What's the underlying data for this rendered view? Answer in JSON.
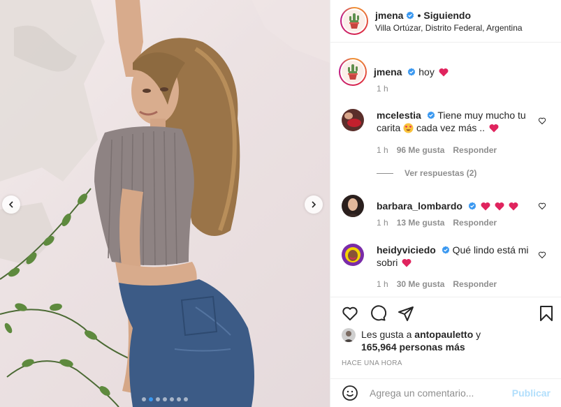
{
  "post": {
    "username": "jmena",
    "following_label": "Siguiendo",
    "location": "Villa Ortúzar, Distrito Federal, Argentina"
  },
  "caption": {
    "username": "jmena",
    "text": "hoy",
    "time": "1 h"
  },
  "comments": [
    {
      "username": "mcelestia",
      "text_part1": "Tiene muy mucho tu carita",
      "text_part2": "cada vez más ..",
      "time": "1 h",
      "likes": "96 Me gusta",
      "reply_label": "Responder",
      "view_replies": "Ver respuestas (2)"
    },
    {
      "username": "barbara_lombardo",
      "text": "",
      "time": "1 h",
      "likes": "13 Me gusta",
      "reply_label": "Responder"
    },
    {
      "username": "heidyviciedo",
      "text": "Qué lindo está mi sobri",
      "time": "1 h",
      "likes": "30 Me gusta",
      "reply_label": "Responder"
    }
  ],
  "likes": {
    "prefix": "Les gusta a",
    "user": "antopauletto",
    "conj": "y",
    "others": "165,964 personas más"
  },
  "posted_ago": "HACE UNA HORA",
  "composer": {
    "placeholder": "Agrega un comentario...",
    "publish_label": "Publicar"
  },
  "carousel": {
    "count": 7,
    "active": 1
  },
  "icons": [
    "verified-icon",
    "heart-icon",
    "comment-icon",
    "share-icon",
    "bookmark-icon",
    "emoji-icon",
    "chevron-left-icon",
    "chevron-right-icon"
  ],
  "colors": {
    "accent": "#3897f0",
    "verified": "#3897f0",
    "muted": "#8e8e8e",
    "publish_disabled": "#b2dffc",
    "heart_red": "#ed4956"
  }
}
